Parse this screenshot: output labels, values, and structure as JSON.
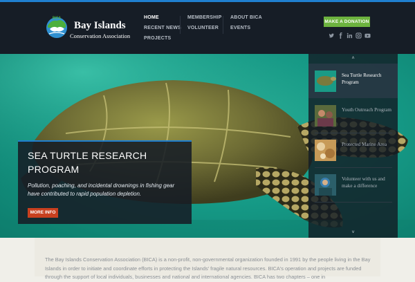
{
  "site": {
    "logo": {
      "badge": "BICA",
      "line1": "Bay Islands",
      "line2": "Conservation Association"
    }
  },
  "nav": {
    "items": [
      {
        "label": "HOME",
        "active": true
      },
      {
        "label": "RECENT NEWS"
      },
      {
        "label": "PROJECTS"
      },
      {
        "label": "MEMBERSHIP"
      },
      {
        "label": "VOLUNTEER"
      },
      {
        "label": "ABOUT BICA"
      },
      {
        "label": "EVENTS"
      }
    ],
    "donate_label": "MAKE A DONATION",
    "social_icons": [
      "twitter-icon",
      "facebook-icon",
      "linkedin-icon",
      "instagram-icon",
      "youtube-icon"
    ]
  },
  "hero": {
    "title": "SEA TURTLE RESEARCH PROGRAM",
    "text": "Pollution, poaching, and incidental drownings in fishing gear have contributed to rapid population depletion.",
    "button_label": "MORE INFO"
  },
  "slider": {
    "up_arrow": "˄",
    "down_arrow": "˅",
    "items": [
      {
        "label": "Sea Turtle Research Program",
        "active": true
      },
      {
        "label": "Youth Outreach Program"
      },
      {
        "label": "Protected Marine Area"
      },
      {
        "label": "Volunteer with us and make a difference"
      }
    ]
  },
  "intro": {
    "text": "The Bay Islands Conservation Association (BICA) is a non-profit, non-governmental organization founded in 1991 by the people living in the Bay Islands in order to initiate and coordinate efforts in protecting the Islands' fragile natural resources. BICA's operation and projects are funded through the support of local individuals, businesses and national and international agencies. BICA has two chapters – one in"
  },
  "colors": {
    "accent_blue": "#1f7fd0",
    "donate_green": "#6db33f",
    "more_info_red": "#c8401f",
    "header_bg": "#161d26"
  }
}
